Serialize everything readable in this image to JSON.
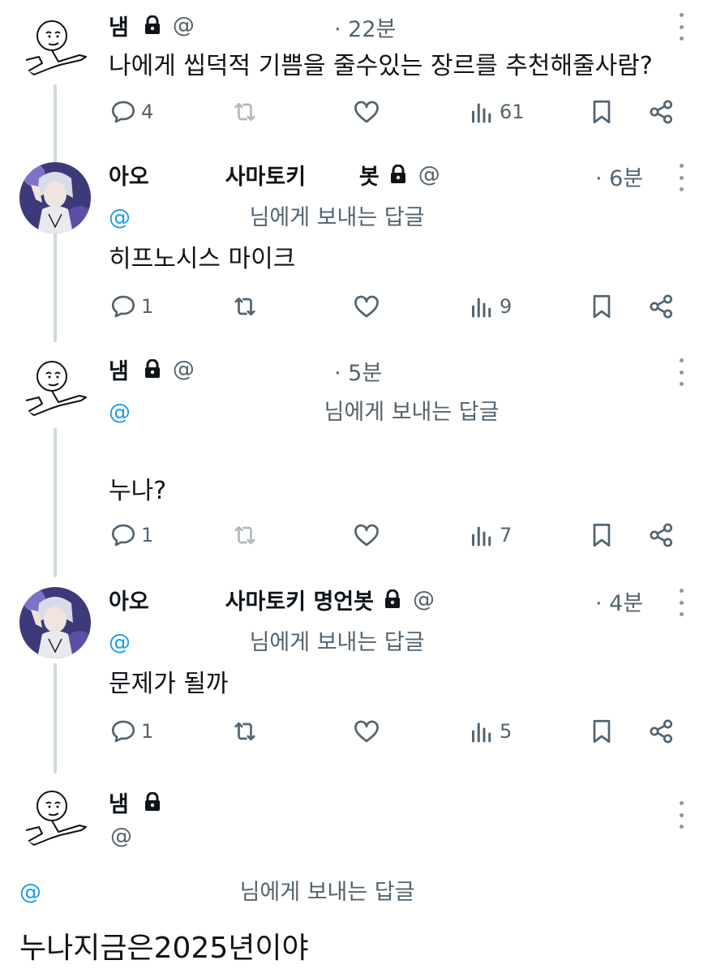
{
  "tweets": [
    {
      "name": "냄",
      "handle": "@",
      "time": "· 22분",
      "text": "나에게 씹덕적 기쁨을 줄수있는 장르를 추천해줄사람?",
      "replies": "4",
      "views": "61",
      "avatar": "stickman"
    },
    {
      "name": "아오          사마토키       봇",
      "handle": "@",
      "time": "· 6분",
      "reply_at": "@",
      "reply_text": "님에게 보내는 답글",
      "text": "히프노시스 마이크",
      "replies": "1",
      "views": "9",
      "avatar": "anime"
    },
    {
      "name": "냄",
      "handle": "@",
      "time": "· 5분",
      "reply_at": "@",
      "reply_text": "님에게 보내는 답글",
      "text": "누나?",
      "replies": "1",
      "views": "7",
      "avatar": "stickman"
    },
    {
      "name": "아오          사마토키 명언봇",
      "handle": "@",
      "time": "· 4분",
      "reply_at": "@",
      "reply_text": "님에게 보내는 답글",
      "text": "문제가 될까",
      "replies": "1",
      "views": "5",
      "avatar": "anime"
    },
    {
      "name": "냄",
      "handle": "@",
      "reply_at": "@",
      "reply_text": "님에게 보내는 답글",
      "text": "누나지금은2025년이야",
      "avatar": "stickman"
    }
  ],
  "icons": {
    "reply": "speech-bubble-icon",
    "retweet": "retweet-icon",
    "like": "heart-icon",
    "views": "bar-chart-icon",
    "bookmark": "bookmark-icon",
    "share": "share-icon",
    "lock": "lock-icon",
    "more": "more-dots-icon"
  },
  "colors": {
    "text": "#0f1419",
    "secondary": "#536471",
    "link": "#1d9bf0",
    "thread_line": "#cfd9de"
  }
}
